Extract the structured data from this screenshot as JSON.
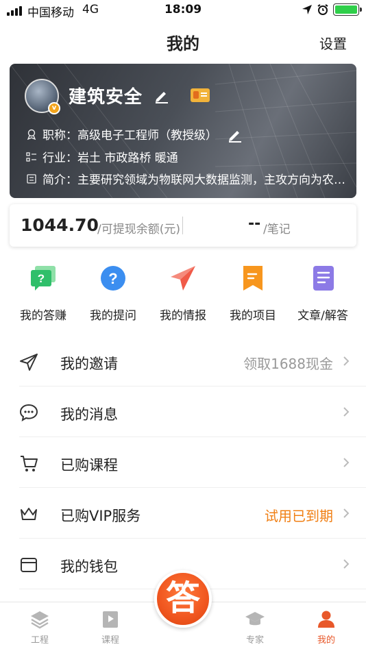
{
  "status_bar": {
    "carrier": "中国移动",
    "network": "4G",
    "time": "18:09"
  },
  "nav": {
    "title": "我的",
    "settings_label": "设置"
  },
  "profile": {
    "name": "建筑安全",
    "avatar_badge": "v",
    "title_label": "职称：",
    "title_value": "高级电子工程师（教授级）",
    "industry_label": "行业：",
    "industry_value": "岩土 市政路桥 暖通",
    "intro_label": "简介：",
    "intro_value": "主要研究领域为物联网大数据监测，主攻方向为农…"
  },
  "balance": {
    "amount": "1044.70",
    "amount_label": "/可提现余额(元)",
    "notes_value": "--",
    "notes_label": "/笔记"
  },
  "actions": [
    {
      "label": "我的答赚",
      "icon": "chat-question-icon",
      "color": "#2fbf6a"
    },
    {
      "label": "我的提问",
      "icon": "question-circle-icon",
      "color": "#3b8ef0"
    },
    {
      "label": "我的情报",
      "icon": "paper-plane-icon",
      "color": "#f05a48"
    },
    {
      "label": "我的项目",
      "icon": "bookmark-icon",
      "color": "#f7961e"
    },
    {
      "label": "文章/解答",
      "icon": "document-icon",
      "color": "#8c7ae6"
    }
  ],
  "menu": [
    {
      "label": "我的邀请",
      "value": "领取1688现金",
      "icon": "send-icon"
    },
    {
      "label": "我的消息",
      "value": "",
      "icon": "message-icon"
    },
    {
      "label": "已购课程",
      "value": "",
      "icon": "cart-icon"
    },
    {
      "label": "已购VIP服务",
      "value": "试用已到期",
      "icon": "crown-icon"
    },
    {
      "label": "我的钱包",
      "value": "",
      "icon": "wallet-icon"
    }
  ],
  "tabs": [
    {
      "label": "工程",
      "icon": "layers-icon"
    },
    {
      "label": "课程",
      "icon": "play-book-icon"
    },
    {
      "label": "专家",
      "icon": "graduation-cap-icon"
    },
    {
      "label": "我的",
      "icon": "person-icon"
    }
  ],
  "center_button": {
    "label": "答"
  },
  "colors": {
    "accent": "#f07f14",
    "active_tab": "#e8582a"
  }
}
